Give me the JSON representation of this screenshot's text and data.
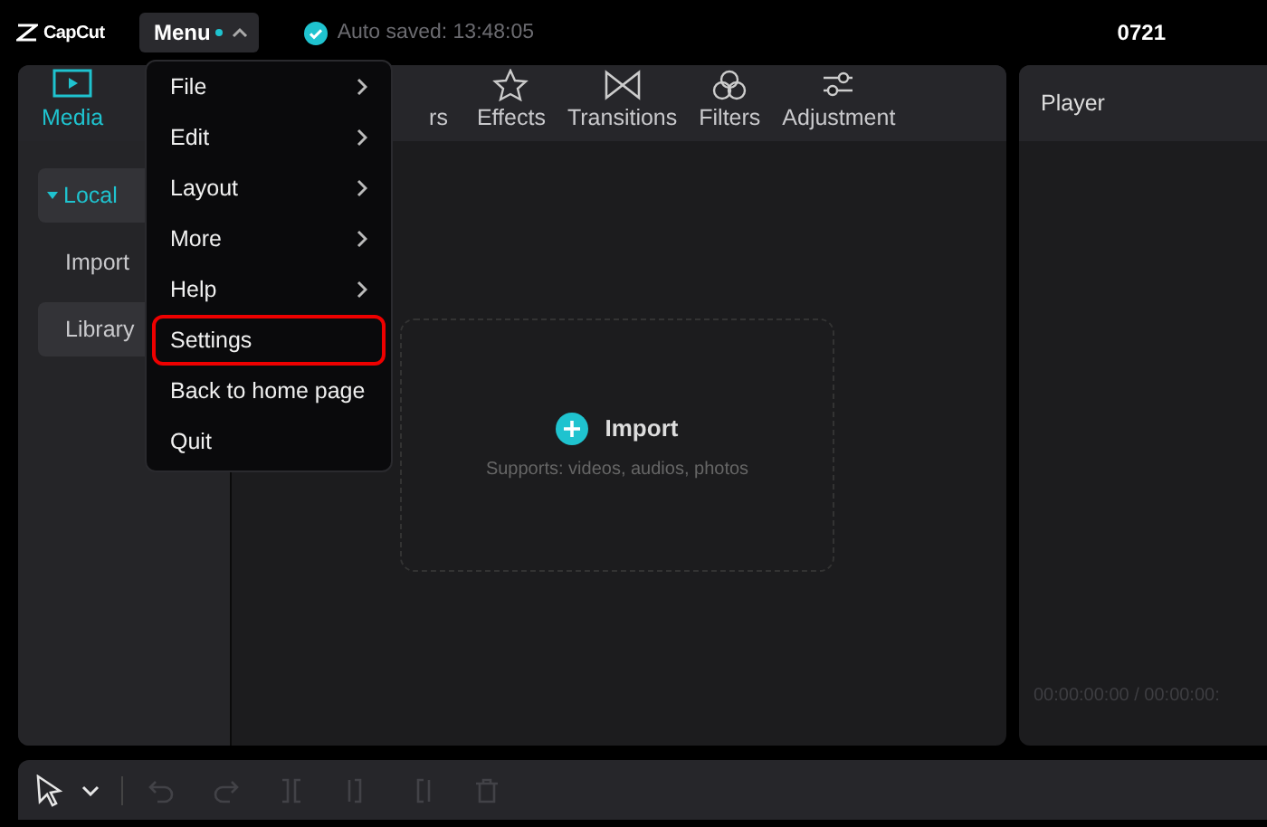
{
  "app": {
    "logo": "CapCut",
    "menu_button": "Menu",
    "autosave": "Auto saved: 13:48:05",
    "project": "0721"
  },
  "tabs": [
    {
      "label": "Media",
      "selected": true,
      "kind": "media"
    },
    {
      "label": "rs",
      "selected": false,
      "kind": "partial"
    },
    {
      "label": "Effects",
      "selected": false,
      "kind": "effects"
    },
    {
      "label": "Transitions",
      "selected": false,
      "kind": "transitions"
    },
    {
      "label": "Filters",
      "selected": false,
      "kind": "filters"
    },
    {
      "label": "Adjustment",
      "selected": false,
      "kind": "adjustment"
    }
  ],
  "sidebar": {
    "items": [
      {
        "label": "Local",
        "selected": false,
        "kind": "group",
        "expanded": true
      },
      {
        "label": "Import",
        "selected": false,
        "kind": "item"
      },
      {
        "label": "Library",
        "selected": true,
        "kind": "item"
      }
    ]
  },
  "import_area": {
    "label": "Import",
    "hint": "Supports: videos, audios, photos"
  },
  "player": {
    "title": "Player",
    "timecode": "00:00:00:00 / 00:00:00:"
  },
  "menu": {
    "items": [
      {
        "label": "File",
        "submenu": true,
        "highlighted": false
      },
      {
        "label": "Edit",
        "submenu": true,
        "highlighted": false
      },
      {
        "label": "Layout",
        "submenu": true,
        "highlighted": false
      },
      {
        "label": "More",
        "submenu": true,
        "highlighted": false
      },
      {
        "label": "Help",
        "submenu": true,
        "highlighted": false
      },
      {
        "label": "Settings",
        "submenu": false,
        "highlighted": true
      },
      {
        "label": "Back to home page",
        "submenu": false,
        "highlighted": false
      },
      {
        "label": "Quit",
        "submenu": false,
        "highlighted": false
      }
    ]
  },
  "toolbar": {
    "tools": [
      {
        "kind": "select",
        "disabled": false
      },
      {
        "kind": "caret",
        "disabled": false
      },
      {
        "kind": "divider"
      },
      {
        "kind": "undo",
        "disabled": true
      },
      {
        "kind": "redo",
        "disabled": true
      },
      {
        "kind": "split",
        "disabled": true
      },
      {
        "kind": "split-left",
        "disabled": true
      },
      {
        "kind": "split-right",
        "disabled": true
      },
      {
        "kind": "delete",
        "disabled": true
      }
    ]
  }
}
